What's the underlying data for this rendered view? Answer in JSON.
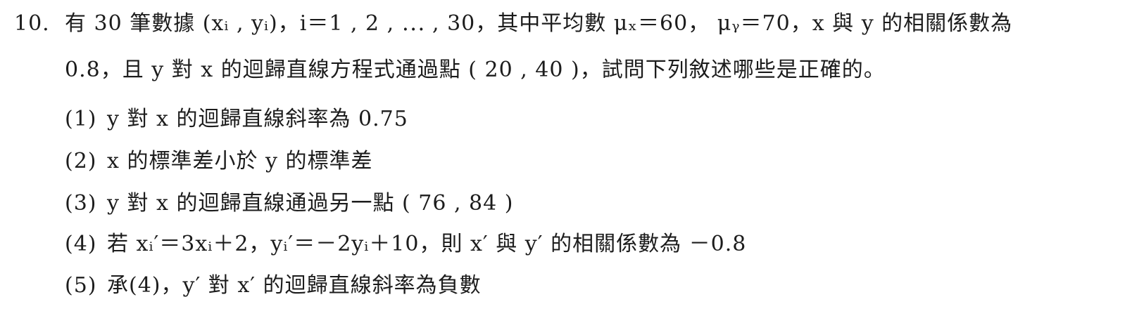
{
  "question": {
    "number": "10.",
    "stem_line1": "有 30 筆數據 (xᵢ , yᵢ)，i＝1 , 2 , ⋯ , 30，其中平均數 μₓ＝60， μᵧ＝70，x 與 y 的相關係數為",
    "stem_line2": "0.8，且 y 對 x 的迴歸直線方程式通過點 ( 20 , 40 )，試問下列敘述哪些是正確的。"
  },
  "options": [
    {
      "label": "(1)",
      "text": "y 對 x 的迴歸直線斜率為 0.75"
    },
    {
      "label": "(2)",
      "text": "x 的標準差小於 y 的標準差"
    },
    {
      "label": "(3)",
      "text": "y 對 x 的迴歸直線通過另一點 ( 76 , 84 )"
    },
    {
      "label": "(4)",
      "text": "若 xᵢ′＝3xᵢ＋2，yᵢ′＝－2yᵢ＋10，則 x′ 與 y′ 的相關係數為 －0.8"
    },
    {
      "label": "(5)",
      "text": "承(4)，y′ 對 x′ 的迴歸直線斜率為負數"
    }
  ]
}
